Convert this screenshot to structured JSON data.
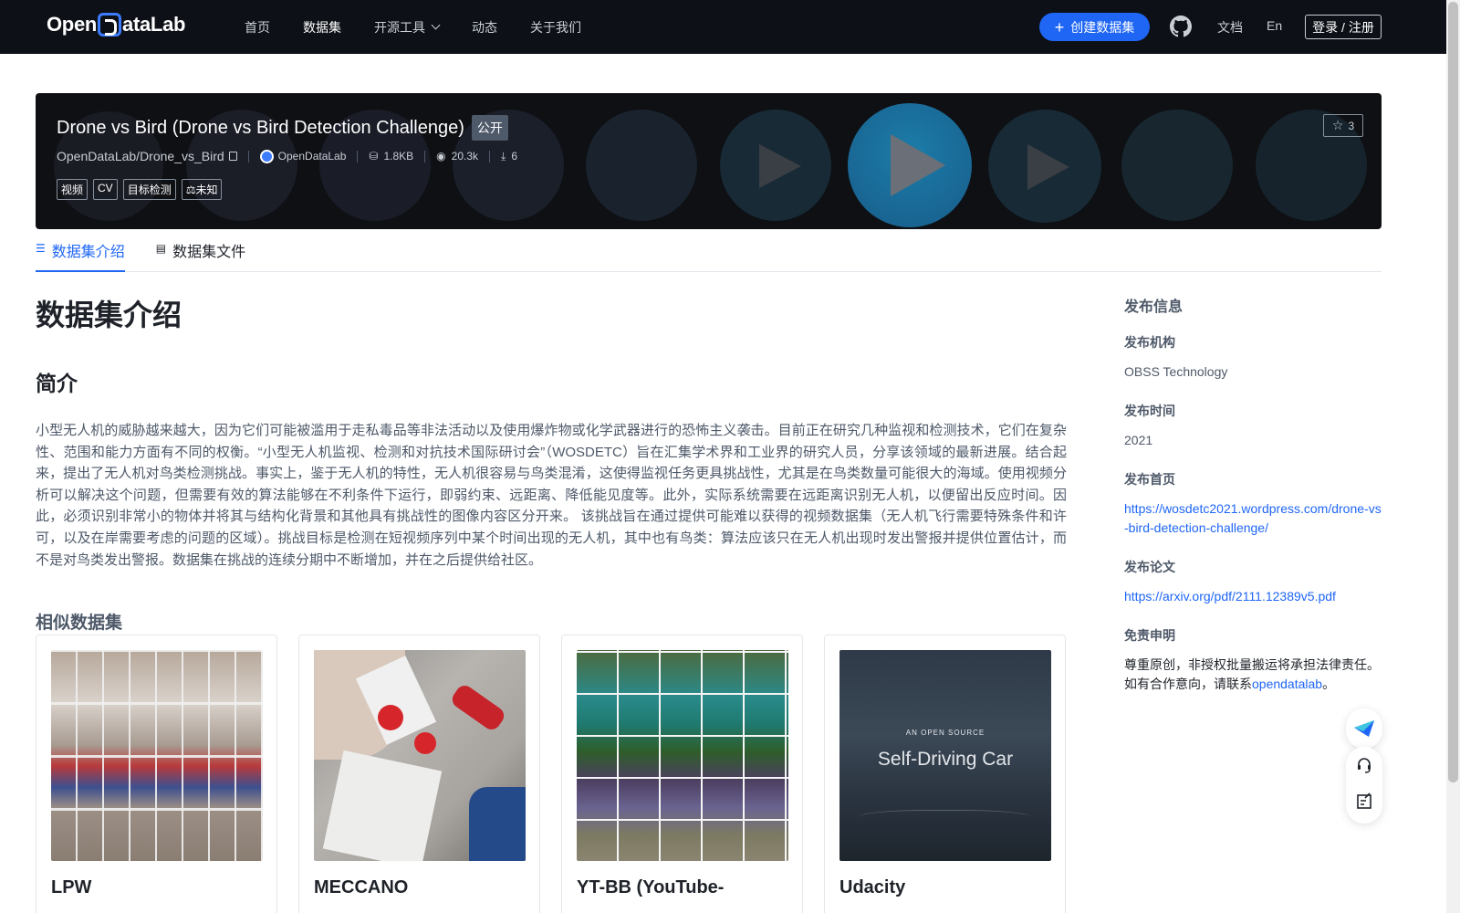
{
  "nav": {
    "logo_left": "Open",
    "logo_right": "ataLab",
    "links": [
      "首页",
      "数据集",
      "开源工具",
      "动态",
      "关于我们"
    ],
    "active_index": 1,
    "create_label": "创建数据集",
    "docs_label": "文档",
    "lang_label": "En",
    "login_label": "登录 / 注册"
  },
  "dataset": {
    "title": "Drone vs Bird (Drone vs Bird Detection Challenge)",
    "visibility": "公开",
    "repo": "OpenDataLab/Drone_vs_Bird",
    "org": "OpenDataLab",
    "size": "1.8KB",
    "views": "20.3k",
    "downloads": "6",
    "tags": [
      "视频",
      "CV",
      "目标检测",
      "未知"
    ],
    "stars": "3"
  },
  "tabs": [
    "数据集介绍",
    "数据集文件"
  ],
  "intro": {
    "heading": "数据集介绍",
    "subheading": "简介",
    "description": "小型无人机的威胁越来越大，因为它们可能被滥用于走私毒品等非法活动以及使用爆炸物或化学武器进行的恐怖主义袭击。目前正在研究几种监视和检测技术，它们在复杂性、范围和能力方面有不同的权衡。“小型无人机监视、检测和对抗技术国际研讨会”（WOSDETC）旨在汇集学术界和工业界的研究人员，分享该领域的最新进展。结合起来，提出了无人机对鸟类检测挑战。事实上，鉴于无人机的特性，无人机很容易与鸟类混淆，这使得监视任务更具挑战性，尤其是在鸟类数量可能很大的海域。使用视频分析可以解决这个问题，但需要有效的算法能够在不利条件下运行，即弱约束、远距离、降低能见度等。此外，实际系统需要在远距离识别无人机，以便留出反应时间。因此，必须识别非常小的物体并将其与结构化背景和其他具有挑战性的图像内容区分开来。 该挑战旨在通过提供可能难以获得的视频数据集（无人机飞行需要特殊条件和许可，以及在岸需要考虑的问题的区域）。挑战目标是检测在短视频序列中某个时间出现的无人机，其中也有鸟类：算法应该只在无人机出现时发出警报并提供位置估计，而不是对鸟类发出警报。数据集在挑战的连续分期中不断增加，并在之后提供给社区。",
    "similar_heading": "相似数据集",
    "similar": [
      {
        "title": "LPW"
      },
      {
        "title": "MECCANO"
      },
      {
        "title": "YT-BB (YouTube-"
      },
      {
        "title": "Udacity"
      }
    ],
    "udacity_overlay_small": "AN OPEN SOURCE",
    "udacity_overlay_big": "Self-Driving Car"
  },
  "sidebar": {
    "heading": "发布信息",
    "org_label": "发布机构",
    "org_value": "OBSS Technology",
    "time_label": "发布时间",
    "time_value": "2021",
    "home_label": "发布首页",
    "home_value": "https://wosdetc2021.wordpress.com/drone-vs-bird-detection-challenge/",
    "paper_label": "发布论文",
    "paper_value": "https://arxiv.org/pdf/2111.12389v5.pdf",
    "disclaimer_label": "免责申明",
    "disclaimer_text": "尊重原创，非授权批量搬运将承担法律责任。如有合作意向，请联系",
    "disclaimer_link": "opendatalab",
    "disclaimer_end": "。"
  }
}
